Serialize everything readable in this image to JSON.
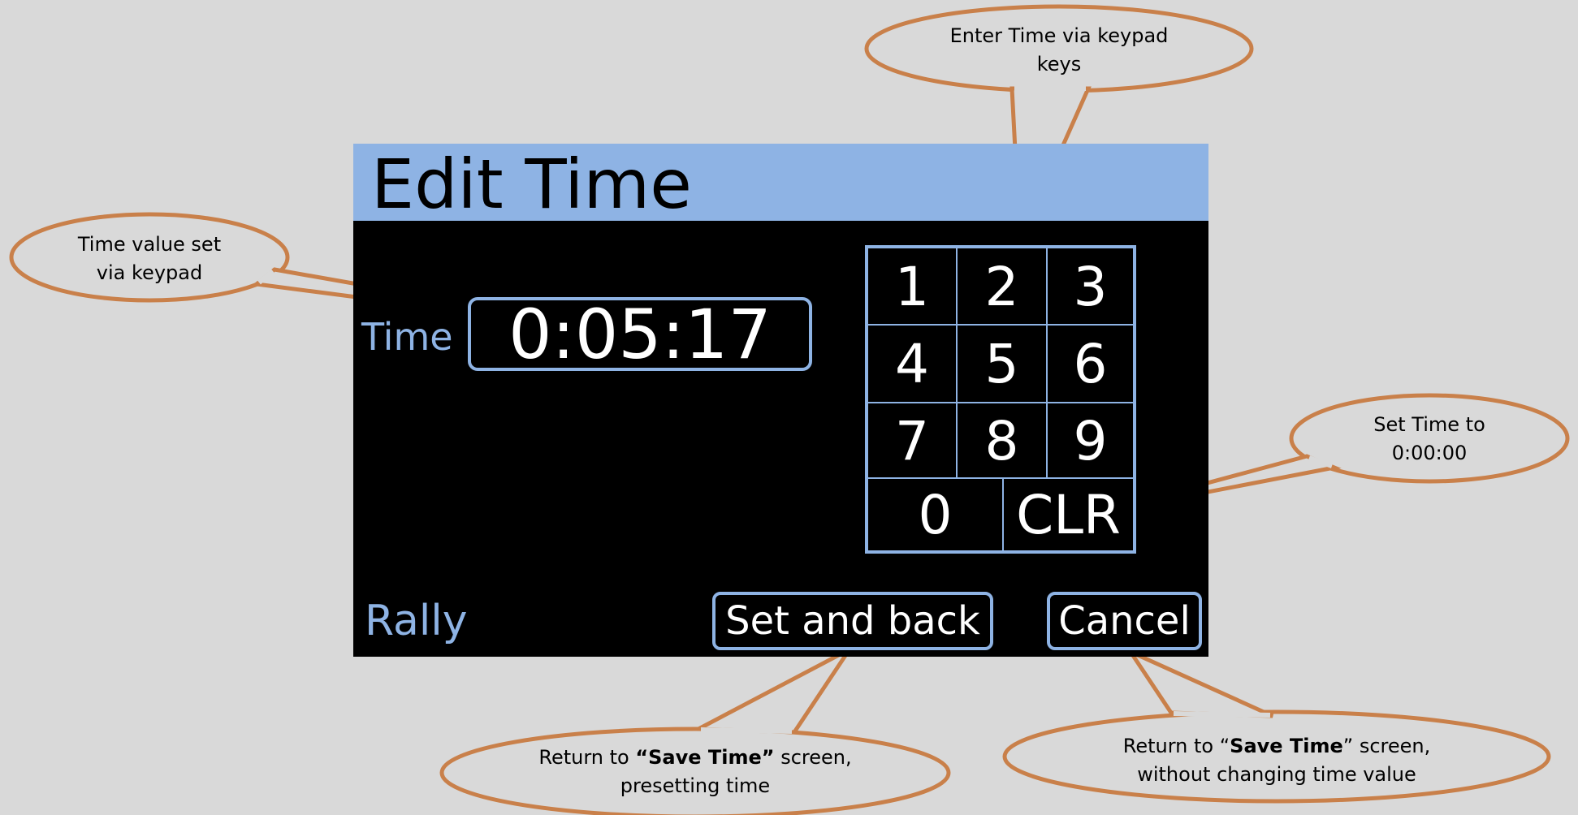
{
  "screen": {
    "title": "Edit Time",
    "time_label": "Time",
    "time_value": "0:05:17",
    "mode_label": "Rally",
    "keypad": {
      "keys": [
        "1",
        "2",
        "3",
        "4",
        "5",
        "6",
        "7",
        "8",
        "9",
        "0",
        "CLR"
      ]
    },
    "buttons": {
      "set_back": "Set and back",
      "cancel": "Cancel"
    }
  },
  "callouts": {
    "keypad": {
      "line1": "Enter Time via keypad",
      "line2": "keys"
    },
    "time_value": {
      "line1": "Time value set",
      "line2": "via keypad"
    },
    "clear": {
      "line1": "Set Time to",
      "line2": "0:00:00"
    },
    "set_back": {
      "prefix": "Return to ",
      "bold": "“Save Time”",
      "suffix": " screen,",
      "line2": "presetting time"
    },
    "cancel": {
      "prefix": "Return to “",
      "bold": "Save Time",
      "suffix": "” screen,",
      "line2": "without changing time value"
    }
  },
  "colors": {
    "background": "#d9d9d9",
    "screen": "#000000",
    "title_bar": "#8eb3e4",
    "ui_accent": "#8eb3e4",
    "callout_stroke": "#c9804a",
    "callout_fill": "#d9d9d9"
  }
}
